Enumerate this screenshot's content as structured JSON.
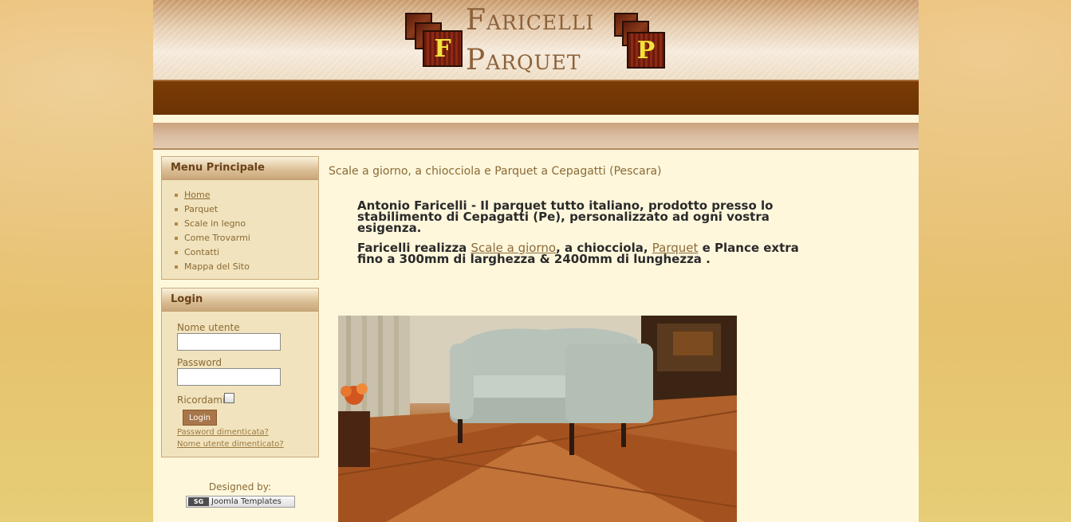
{
  "logo": {
    "line1": "Faricelli",
    "line2": "Parquet",
    "tile_left_letter": "F",
    "tile_right_letter": "P"
  },
  "menu": {
    "title": "Menu Principale",
    "items": [
      {
        "label": "Home",
        "active": true
      },
      {
        "label": "Parquet"
      },
      {
        "label": "Scale in legno"
      },
      {
        "label": "Come Trovarmi"
      },
      {
        "label": "Contatti"
      },
      {
        "label": "Mappa del Sito"
      }
    ]
  },
  "login": {
    "title": "Login",
    "username_label": "Nome utente",
    "username_value": "",
    "password_label": "Password",
    "password_value": "",
    "remember_label": "Ricordami",
    "remember_checked": false,
    "submit_label": "Login",
    "forgot_password": "Password dimenticata?",
    "forgot_username": "Nome utente dimenticato?"
  },
  "footer": {
    "designed_by": "Designed by:",
    "badge_logo": "SG",
    "badge_text": "Joomla Templates"
  },
  "content": {
    "heading": "Scale a giorno, a chiocciola e Parquet a Cepagatti (Pescara)",
    "paragraph1": "Antonio Faricelli - Il parquet tutto italiano, prodotto presso lo stabilimento di Cepagatti (Pe), personalizzato ad ogni vostra esigenza.",
    "p2_part1": "Faricelli realizza ",
    "p2_link1": "Scale a giorno",
    "p2_part2": ", a chiocciola, ",
    "p2_link2": "Parquet",
    "p2_part3": " e Plance extra fino a 300mm di larghezza & 2400mm di lunghezza ."
  },
  "colors": {
    "header_band": "#7a3c06",
    "page_bg": "#fef7dc",
    "module_bg": "#f1e3bd",
    "link": "#8c6a38"
  }
}
